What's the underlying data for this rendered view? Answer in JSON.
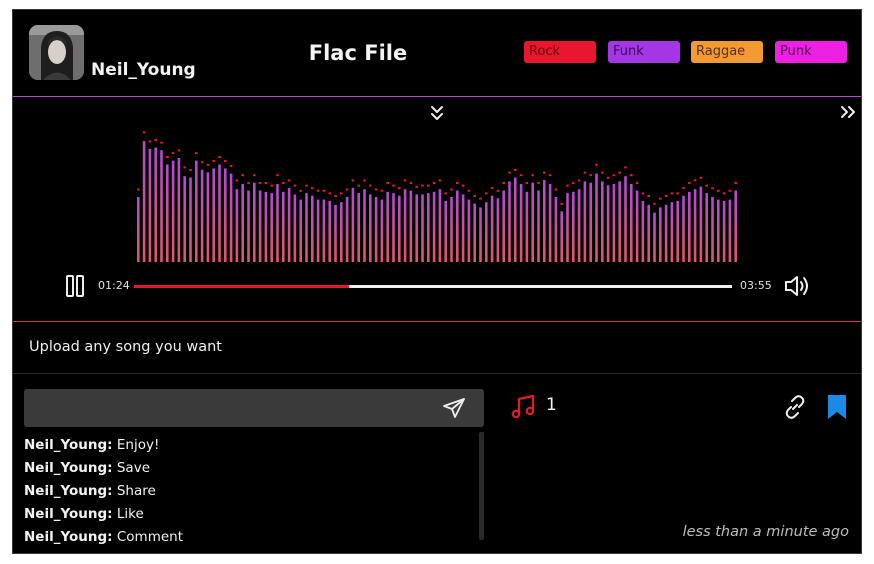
{
  "header": {
    "username": "Neil_Young",
    "song_title": "Flac File",
    "tags": [
      {
        "label": "Rock",
        "color": "#e8162e"
      },
      {
        "label": "Funk",
        "color": "#a436e6"
      },
      {
        "label": "Raggae",
        "color": "#f39a35"
      },
      {
        "label": "Punk",
        "color": "#ee20e4"
      }
    ]
  },
  "player": {
    "time_current": "01:24",
    "time_total": "03:55",
    "progress": 0.36,
    "state": "playing",
    "accent_color": "#e8162e",
    "visualizer_colors": {
      "top": "#b44ad0",
      "bottom": "#e0566a",
      "peak": "#e8162e"
    },
    "visualizer_levels": [
      0.5,
      0.93,
      0.87,
      0.88,
      0.86,
      0.75,
      0.78,
      0.8,
      0.66,
      0.65,
      0.78,
      0.71,
      0.69,
      0.72,
      0.75,
      0.72,
      0.68,
      0.56,
      0.6,
      0.55,
      0.61,
      0.55,
      0.54,
      0.53,
      0.6,
      0.54,
      0.57,
      0.52,
      0.48,
      0.53,
      0.51,
      0.48,
      0.48,
      0.47,
      0.44,
      0.46,
      0.5,
      0.57,
      0.53,
      0.56,
      0.52,
      0.5,
      0.48,
      0.54,
      0.53,
      0.51,
      0.56,
      0.55,
      0.52,
      0.52,
      0.53,
      0.54,
      0.56,
      0.47,
      0.5,
      0.55,
      0.52,
      0.48,
      0.45,
      0.42,
      0.46,
      0.51,
      0.49,
      0.55,
      0.62,
      0.65,
      0.6,
      0.54,
      0.61,
      0.55,
      0.63,
      0.6,
      0.5,
      0.39,
      0.53,
      0.54,
      0.56,
      0.62,
      0.61,
      0.68,
      0.62,
      0.59,
      0.6,
      0.62,
      0.66,
      0.6,
      0.55,
      0.47,
      0.44,
      0.38,
      0.42,
      0.44,
      0.46,
      0.47,
      0.51,
      0.54,
      0.56,
      0.58,
      0.53,
      0.5,
      0.48,
      0.47,
      0.48,
      0.55,
      0.61
    ],
    "peak_levels": [
      0.55,
      0.99,
      0.92,
      0.93,
      0.91,
      0.8,
      0.83,
      0.85,
      0.72,
      0.7,
      0.83,
      0.76,
      0.74,
      0.77,
      0.8,
      0.77,
      0.73,
      0.62,
      0.66,
      0.6,
      0.66,
      0.6,
      0.6,
      0.58,
      0.66,
      0.6,
      0.62,
      0.58,
      0.54,
      0.58,
      0.56,
      0.54,
      0.54,
      0.52,
      0.5,
      0.52,
      0.55,
      0.62,
      0.58,
      0.62,
      0.58,
      0.55,
      0.54,
      0.6,
      0.58,
      0.56,
      0.62,
      0.6,
      0.57,
      0.58,
      0.58,
      0.6,
      0.62,
      0.52,
      0.55,
      0.6,
      0.58,
      0.54,
      0.5,
      0.48,
      0.52,
      0.56,
      0.54,
      0.6,
      0.68,
      0.7,
      0.66,
      0.6,
      0.66,
      0.6,
      0.68,
      0.66,
      0.55,
      0.44,
      0.58,
      0.6,
      0.62,
      0.68,
      0.66,
      0.74,
      0.68,
      0.64,
      0.66,
      0.68,
      0.72,
      0.66,
      0.6,
      0.52,
      0.5,
      0.44,
      0.48,
      0.5,
      0.52,
      0.52,
      0.56,
      0.6,
      0.62,
      0.64,
      0.58,
      0.56,
      0.54,
      0.52,
      0.54,
      0.6,
      0.66
    ]
  },
  "description": "Upload any song you want",
  "comments": {
    "input_value": "",
    "input_placeholder": "",
    "items": [
      {
        "author": "Neil_Young:",
        "text": "Enjoy!"
      },
      {
        "author": "Neil_Young:",
        "text": "Save"
      },
      {
        "author": "Neil_Young:",
        "text": "Share"
      },
      {
        "author": "Neil_Young:",
        "text": "Like"
      },
      {
        "author": "Neil_Young:",
        "text": "Comment"
      }
    ]
  },
  "stats": {
    "song_count": "1",
    "bookmark_color": "#1e88e5",
    "note_color": "#e8162e"
  },
  "timestamp": "less than a minute ago",
  "icons": {
    "collapse": "double-chevron-down-icon",
    "expand": "double-chevron-right-icon",
    "pause": "pause-icon",
    "volume": "volume-icon",
    "send": "send-icon",
    "note": "music-note-icon",
    "link": "link-icon",
    "bookmark": "bookmark-icon"
  }
}
